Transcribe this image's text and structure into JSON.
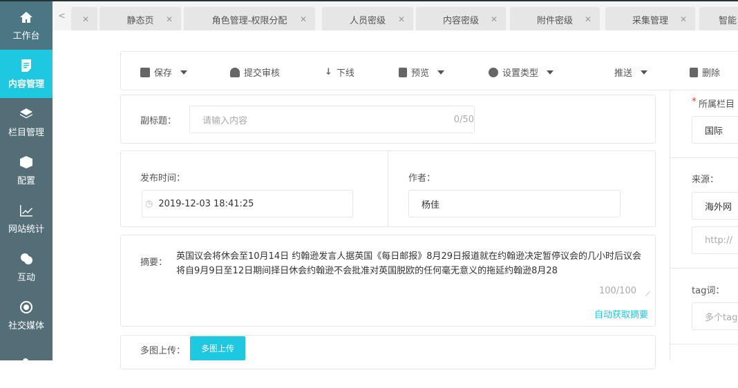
{
  "sidebar": {
    "items": [
      {
        "label": "工作台",
        "icon": "home-icon"
      },
      {
        "label": "内容管理",
        "icon": "document-icon"
      },
      {
        "label": "栏目管理",
        "icon": "layers-icon"
      },
      {
        "label": "配置",
        "icon": "cube-icon"
      },
      {
        "label": "网站统计",
        "icon": "line-chart-icon"
      },
      {
        "label": "互动",
        "icon": "chat-icon"
      },
      {
        "label": "社交媒体",
        "icon": "circle-target-icon"
      }
    ]
  },
  "tabs": [
    "",
    "静态页",
    "角色管理-权限分配",
    "人员密级",
    "内容密级",
    "附件密级",
    "采集管理",
    "智能"
  ],
  "toolbar": {
    "save": "保存",
    "submit": "提交审核",
    "offline": "下线",
    "preview": "预览",
    "set_type": "设置类型",
    "push": "推送",
    "delete": "删除"
  },
  "form": {
    "subtitle_label": "副标题：",
    "subtitle_placeholder": "请输入内容",
    "subtitle_count": "0/50",
    "time_label": "发布时间：",
    "time_value": "2019-12-03 18:41:25",
    "author_label": "作者：",
    "author_value": "杨佳",
    "summary_label": "摘要：",
    "summary_value": "英国议会将休会至10月14日 约翰逊发言人据英国《每日邮报》8月29日报道就在约翰逊决定暂停议会的几小时后议会将自9月9日至12日期间择日休会约翰逊不会批准对英国脱欧的任何毫无意义的拖延约翰逊8月28",
    "summary_count": "100/100",
    "auto_summary": "自动获取摘要",
    "upload_label": "多图上传：",
    "upload_button": "多图上传"
  },
  "right": {
    "column_required": "*",
    "column_label": "所属栏目",
    "column_value": "国际",
    "source_label": "来源：",
    "source_value": "海外网",
    "url_placeholder": "http://",
    "tag_label": "tag词：",
    "tag_placeholder": "多个tag"
  }
}
